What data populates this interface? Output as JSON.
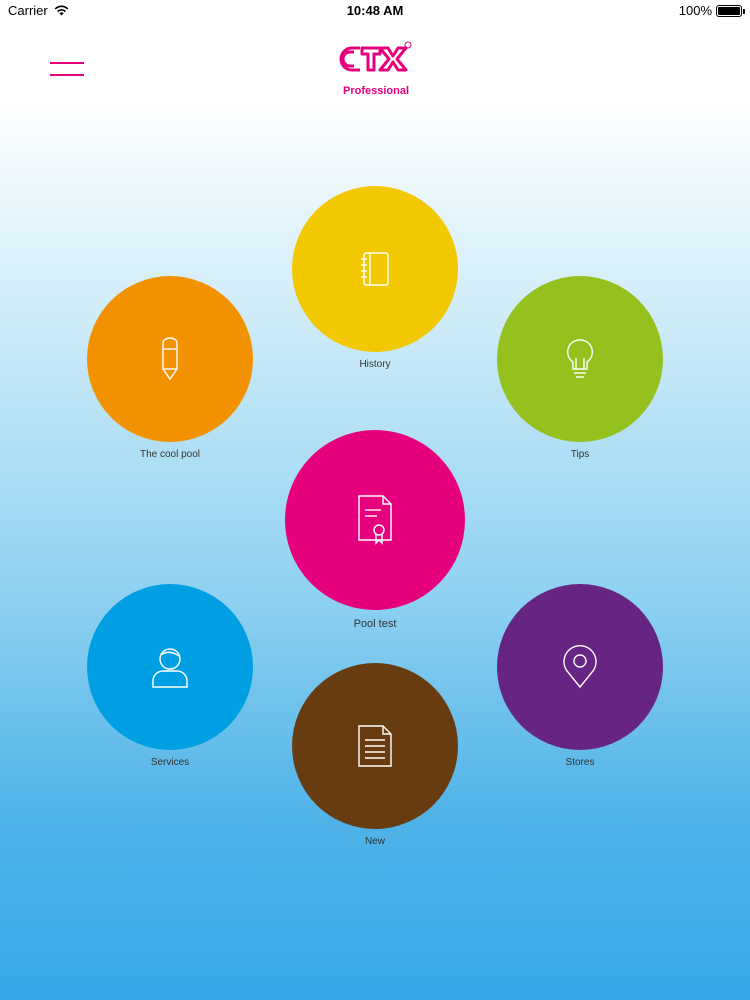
{
  "status_bar": {
    "carrier": "Carrier",
    "time": "10:48 AM",
    "battery": "100%"
  },
  "header": {
    "logo_text": "CTX",
    "logo_subtitle": "Professional",
    "brand_color": "#e6007e"
  },
  "menu": [
    {
      "id": "history",
      "label": "History",
      "color": "#f2c900",
      "icon": "notebook-icon"
    },
    {
      "id": "the-cool-pool",
      "label": "The cool pool",
      "color": "#f39200",
      "icon": "pencil-icon"
    },
    {
      "id": "tips",
      "label": "Tips",
      "color": "#95c11f",
      "icon": "lightbulb-icon"
    },
    {
      "id": "pool-test",
      "label": "Pool test",
      "color": "#e6007e",
      "icon": "certificate-icon"
    },
    {
      "id": "services",
      "label": "Services",
      "color": "#009fe3",
      "icon": "user-icon"
    },
    {
      "id": "stores",
      "label": "Stores",
      "color": "#662483",
      "icon": "location-pin-icon"
    },
    {
      "id": "new",
      "label": "New",
      "color": "#683c11",
      "icon": "document-icon"
    }
  ]
}
